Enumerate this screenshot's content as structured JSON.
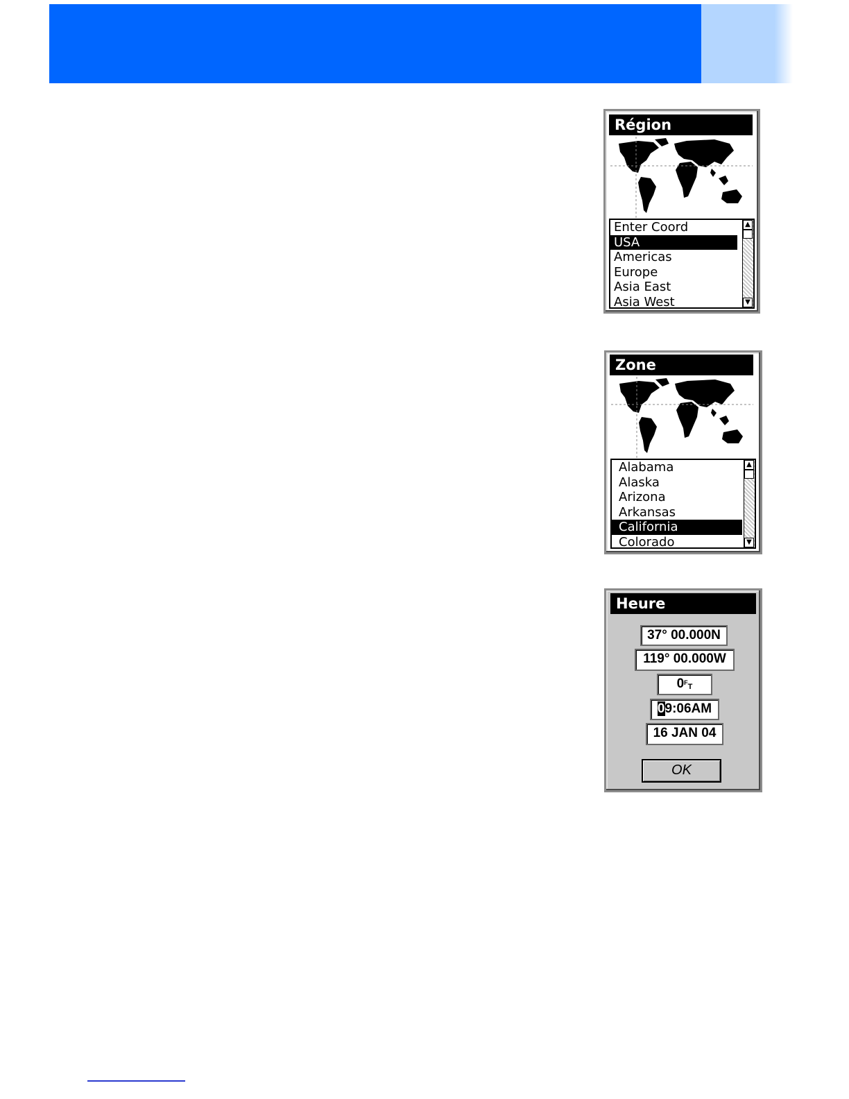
{
  "region_screen": {
    "title": "Région",
    "items": [
      {
        "label": "Enter Coord",
        "selected": false
      },
      {
        "label": "USA",
        "selected": true
      },
      {
        "label": "Americas",
        "selected": false
      },
      {
        "label": "Europe",
        "selected": false
      },
      {
        "label": "Asia East",
        "selected": false
      },
      {
        "label": "Asia West",
        "selected": false
      }
    ]
  },
  "zone_screen": {
    "title": "Zone",
    "items": [
      {
        "label": "Alabama",
        "selected": false
      },
      {
        "label": "Alaska",
        "selected": false
      },
      {
        "label": "Arizona",
        "selected": false
      },
      {
        "label": "Arkansas",
        "selected": false
      },
      {
        "label": "California",
        "selected": true
      },
      {
        "label": "Colorado",
        "selected": false
      }
    ]
  },
  "heure_screen": {
    "title": "Heure",
    "latitude": "37° 00.000N",
    "longitude": "119° 00.000W",
    "altitude_value": "0",
    "altitude_unit_top": "F",
    "altitude_unit_bottom": "T",
    "time_cursor_char": "0",
    "time_rest": "9:06AM",
    "date": "16 JAN 04",
    "ok_label": "OK"
  },
  "colors": {
    "header_blue": "#0066ff",
    "header_tab": "#b4d6ff",
    "footer_line": "#2a3ad0"
  }
}
